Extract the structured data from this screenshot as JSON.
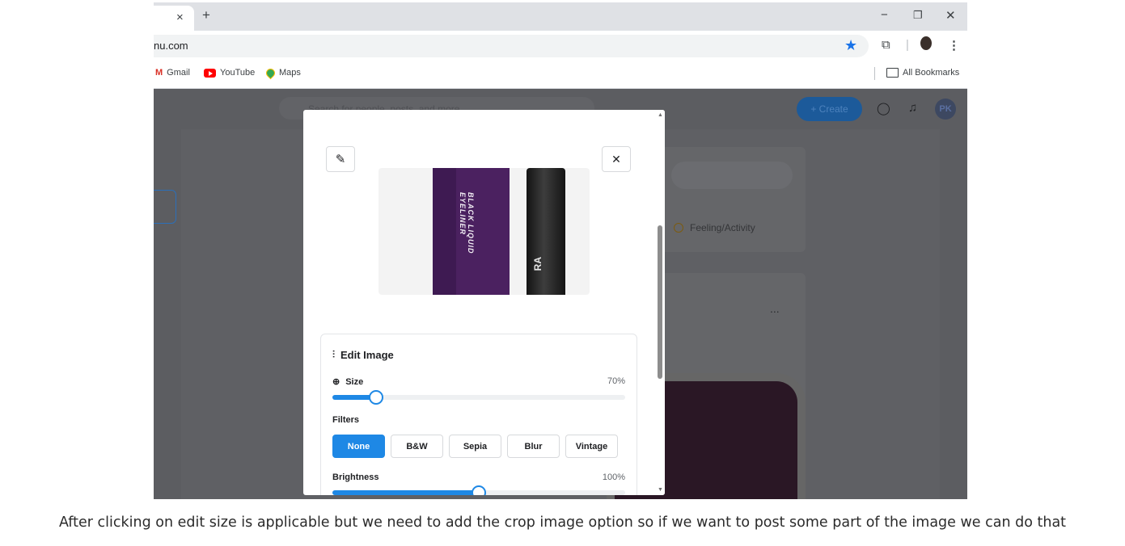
{
  "browser": {
    "tab_close": "×",
    "new_tab": "+",
    "window_controls": {
      "minimize": "−",
      "restore": "❐",
      "close": "✕"
    },
    "url": "nu.com",
    "bookmarks": [
      {
        "label": "Gmail",
        "icon": "gmail-icon"
      },
      {
        "label": "YouTube",
        "icon": "youtube-icon"
      },
      {
        "label": "Maps",
        "icon": "maps-icon"
      }
    ],
    "all_bookmarks": "All Bookmarks"
  },
  "app": {
    "search_placeholder": "Search for people, posts, and more",
    "create_label": "+ Create",
    "avatar_initials": "PK",
    "feeling_label": "Feeling/Activity",
    "more_label": "..."
  },
  "modal": {
    "image_text_box": "BLACK LIQUID EYELINER",
    "image_text_pen": "RA",
    "edit_title": "Edit Image",
    "size": {
      "label": "Size",
      "value_text": "70%",
      "value": 0.15
    },
    "filters_label": "Filters",
    "filters": [
      "None",
      "B&W",
      "Sepia",
      "Blur",
      "Vintage"
    ],
    "active_filter": "None",
    "brightness": {
      "label": "Brightness",
      "value_text": "100%",
      "value": 0.5
    }
  },
  "caption": "After clicking on edit size is applicable but we need to add the crop image option so if we want to post some part of the image we can do that"
}
